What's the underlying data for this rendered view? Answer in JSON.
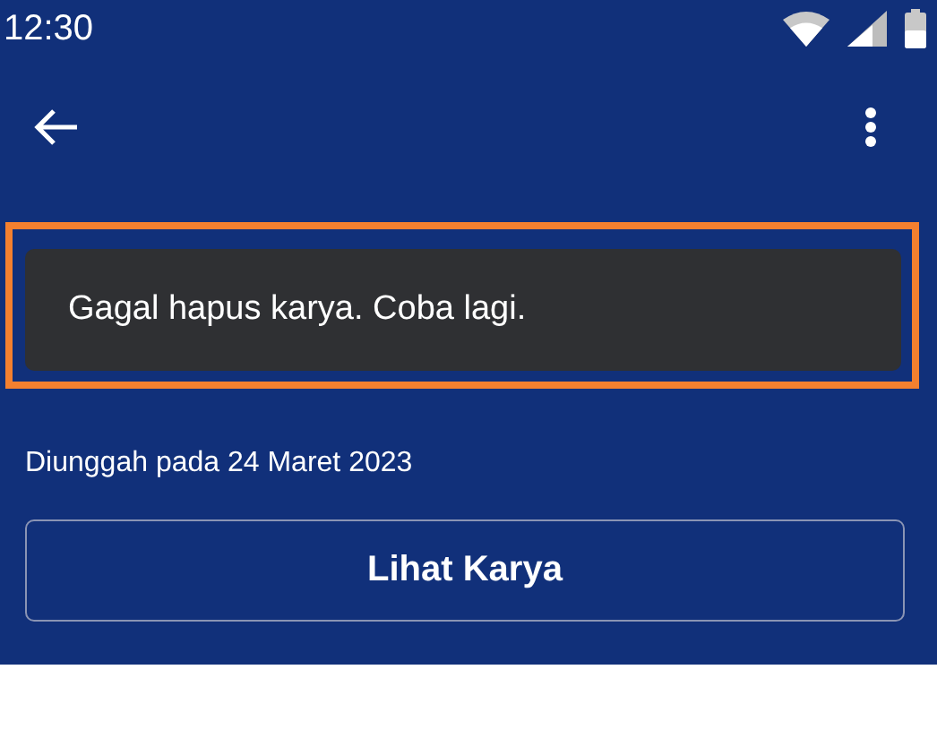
{
  "status_bar": {
    "time": "12:30"
  },
  "content": {
    "upload_date": "Diunggah pada 24 Maret 2023",
    "button": "Lihat Karya"
  },
  "snackbar": {
    "message": "Gagal hapus karya. Coba lagi.",
    "highlighted": true
  }
}
